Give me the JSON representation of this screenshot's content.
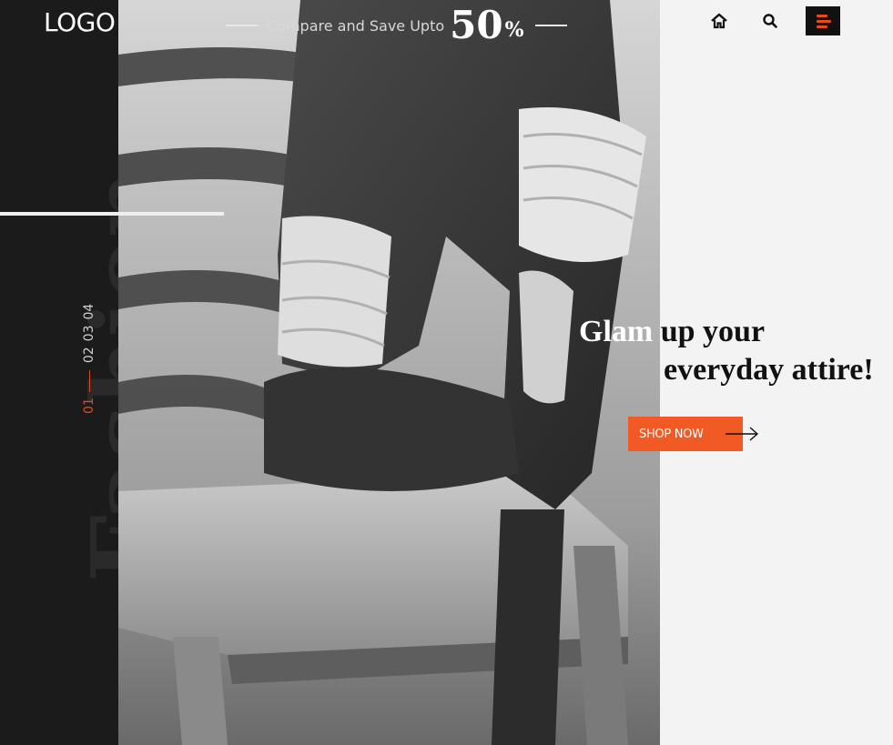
{
  "header": {
    "logo": "LOGO",
    "promo": {
      "text": "Compare and Save Upto",
      "value": "50",
      "unit": "%"
    },
    "nav": {
      "home_icon": "home-icon",
      "search_icon": "search-icon",
      "menu_icon": "hamburger-menu-icon"
    }
  },
  "sidebar": {
    "watermark": "Fashion",
    "pager": {
      "active": "01",
      "pages": [
        "02",
        "03",
        "04"
      ]
    }
  },
  "hero": {
    "headline_line1_part1": "Glam",
    "headline_line1_part2": " up your",
    "headline_line2": "everyday attire!",
    "cta_label": "SHOP NOW",
    "cta_icon": "arrow-right-icon"
  },
  "colors": {
    "accent": "#f15a24",
    "sidebar_bg": "#1b1b1b",
    "panel_bg": "#f3f3f3"
  }
}
